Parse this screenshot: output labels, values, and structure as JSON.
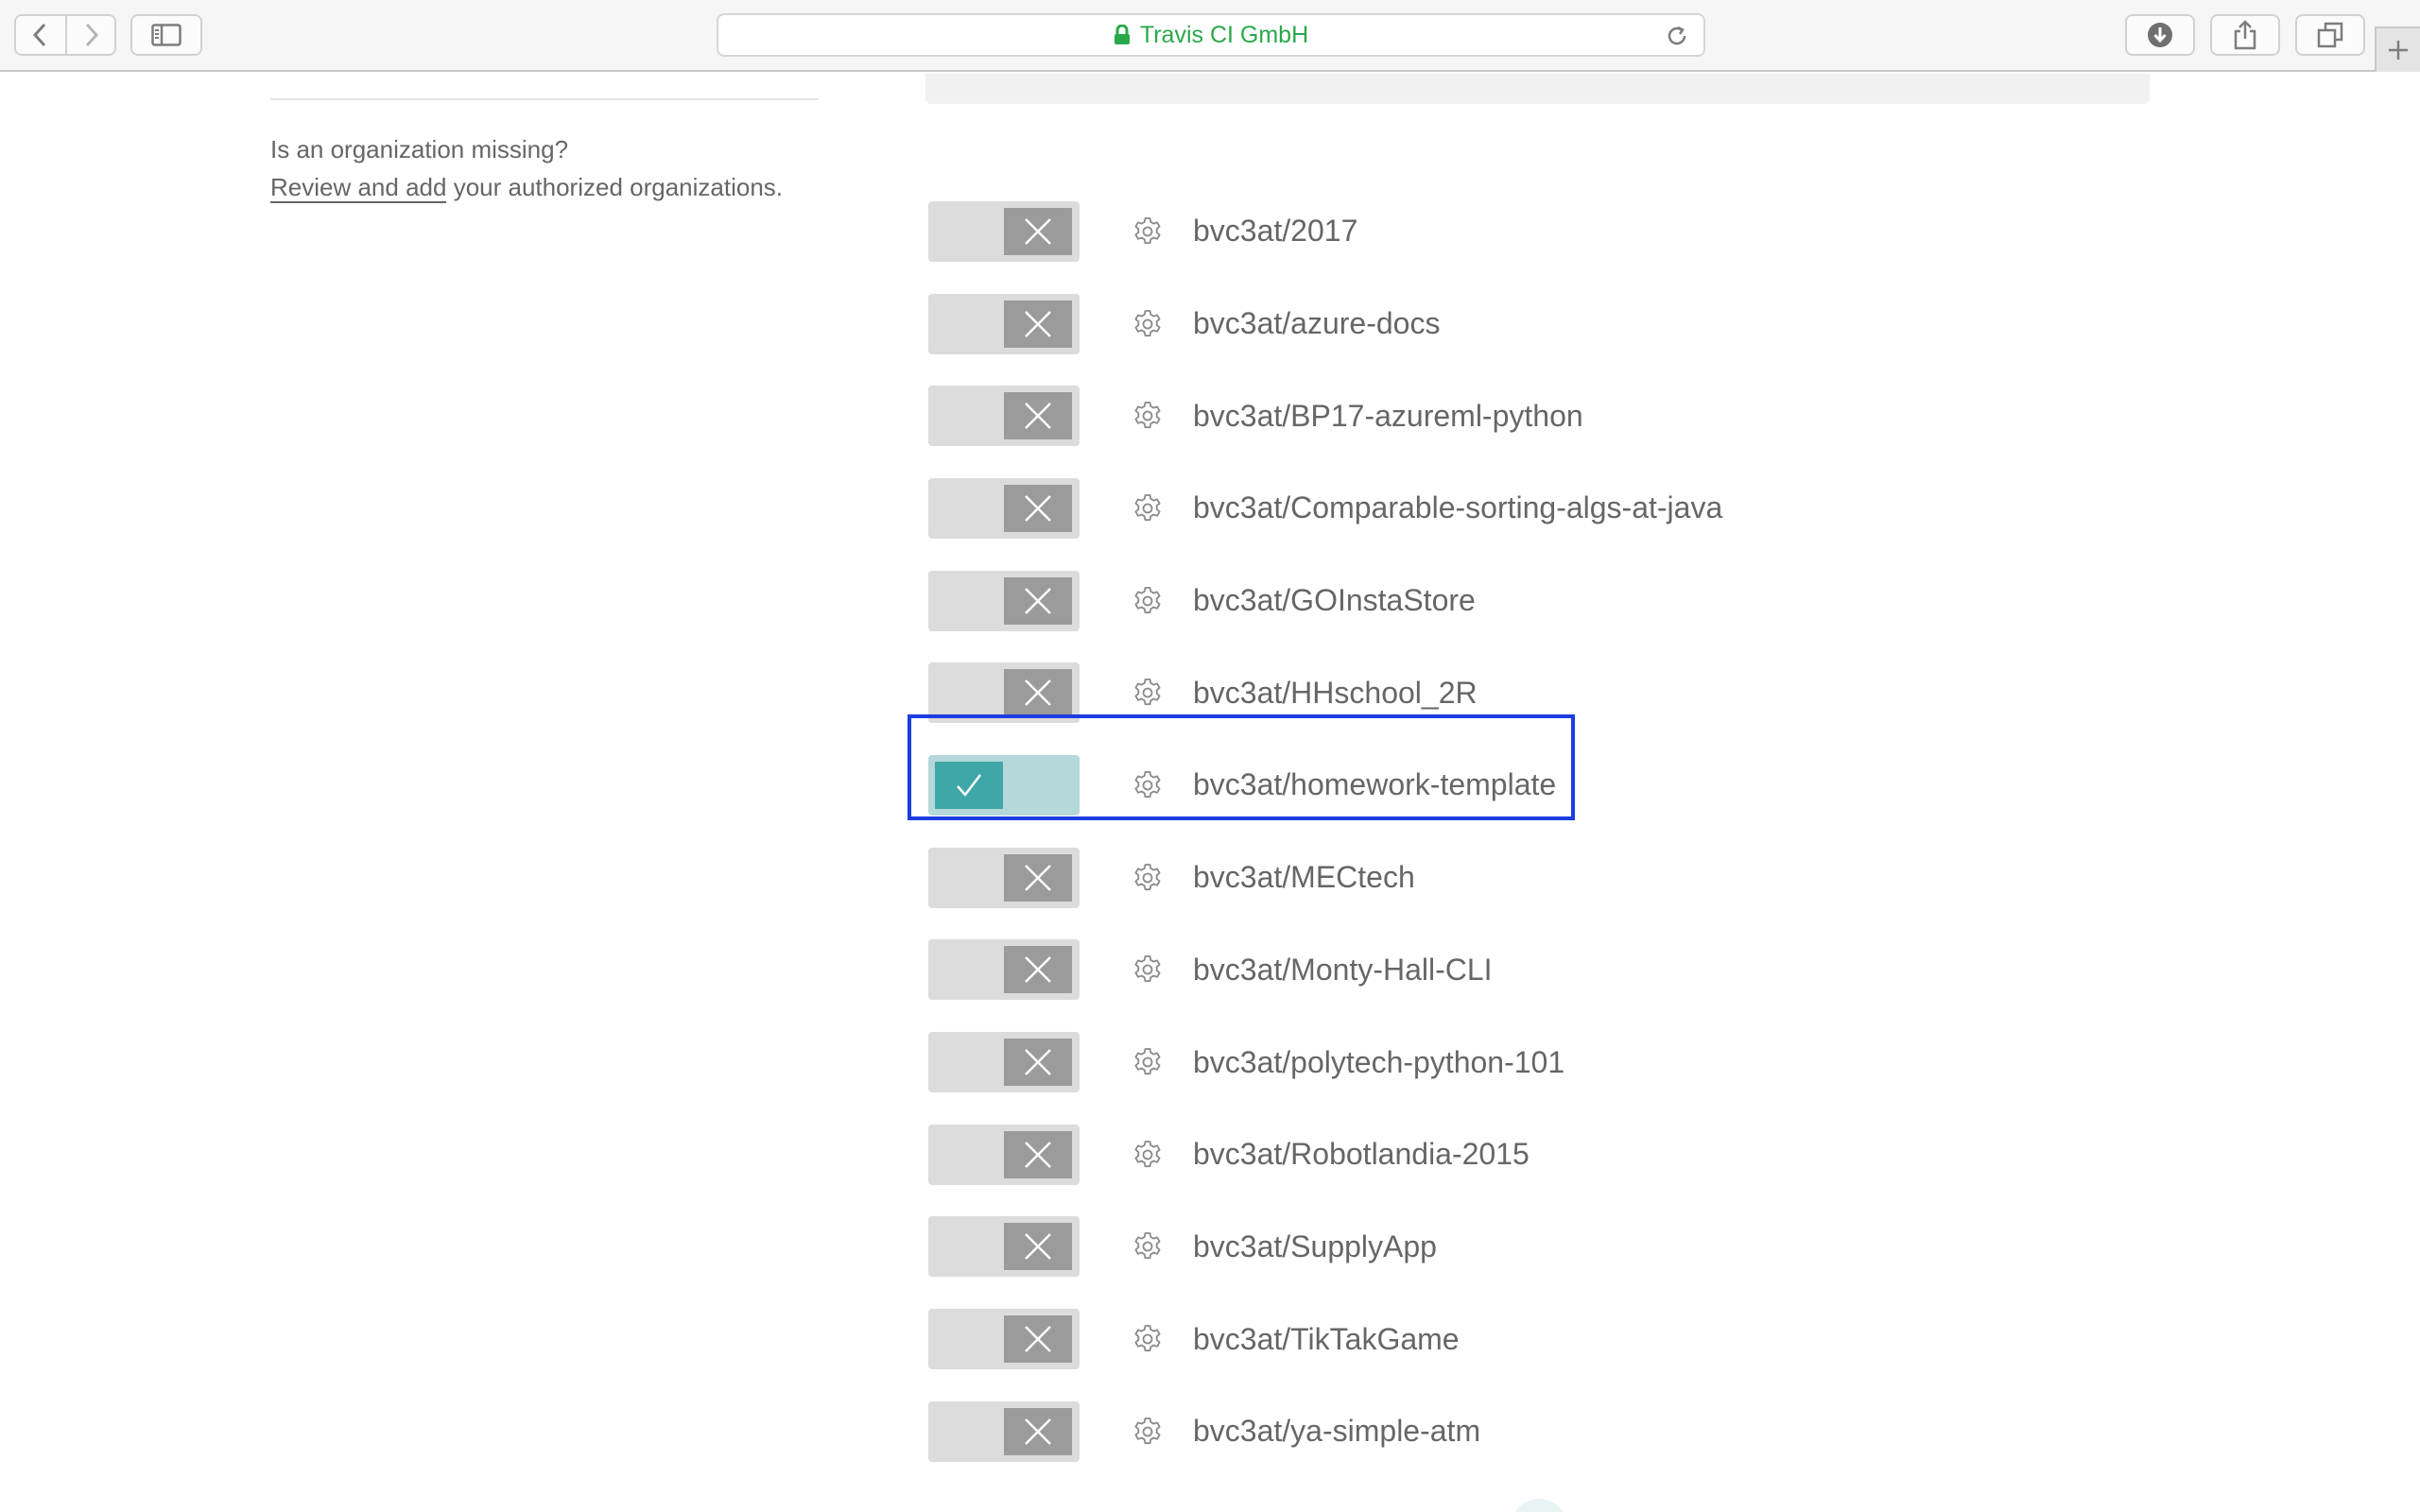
{
  "browser": {
    "url_display": "Travis CI GmbH",
    "secure": true,
    "buttons": {
      "back": "chevron-left-icon",
      "forward": "chevron-right-icon",
      "sidebar": "sidebar-icon",
      "reload": "reload-icon",
      "downloads": "download-icon",
      "share": "share-icon",
      "tabs": "tabs-icon",
      "new_tab": "plus-icon"
    }
  },
  "sidebar": {
    "question": "Is an organization missing?",
    "link_text": "Review and add",
    "trailing_text": " your authorized organizations."
  },
  "repos": [
    {
      "name": "bvc3at/2017",
      "active": false
    },
    {
      "name": "bvc3at/azure-docs",
      "active": false
    },
    {
      "name": "bvc3at/BP17-azureml-python",
      "active": false
    },
    {
      "name": "bvc3at/Comparable-sorting-algs-at-java",
      "active": false
    },
    {
      "name": "bvc3at/GOInstaStore",
      "active": false
    },
    {
      "name": "bvc3at/HHschool_2R",
      "active": false
    },
    {
      "name": "bvc3at/homework-template",
      "active": true
    },
    {
      "name": "bvc3at/MECtech",
      "active": false
    },
    {
      "name": "bvc3at/Monty-Hall-CLI",
      "active": false
    },
    {
      "name": "bvc3at/polytech-python-101",
      "active": false
    },
    {
      "name": "bvc3at/Robotlandia-2015",
      "active": false
    },
    {
      "name": "bvc3at/SupplyApp",
      "active": false
    },
    {
      "name": "bvc3at/TikTakGame",
      "active": false
    },
    {
      "name": "bvc3at/ya-simple-atm",
      "active": false
    }
  ],
  "colors": {
    "toggle_on": "#40a7a8",
    "toggle_off": "#9b9b9b",
    "secure_green": "#29a84a",
    "highlight": "#1c3de0"
  }
}
